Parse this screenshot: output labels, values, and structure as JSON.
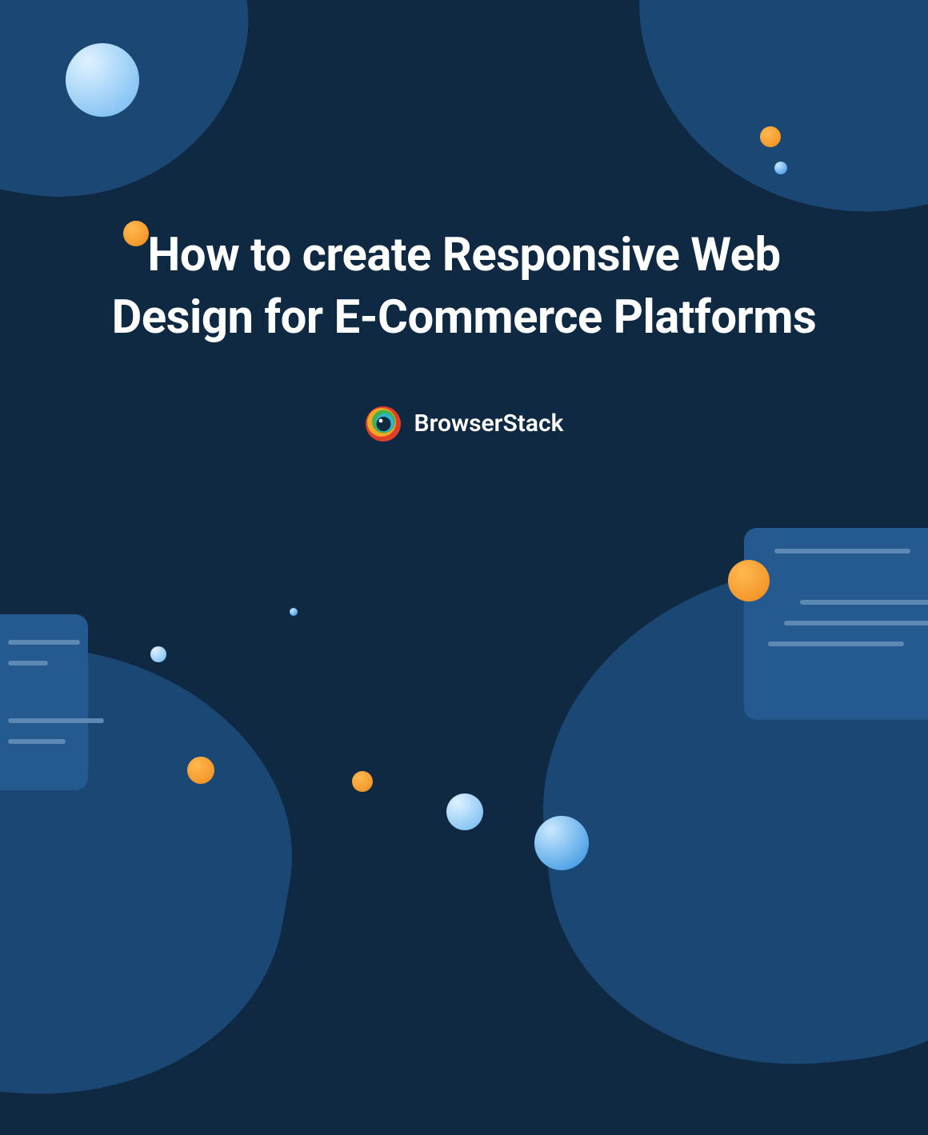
{
  "title": "How to create Responsive Web Design for E-Commerce Platforms",
  "brand": {
    "name": "BrowserStack"
  },
  "colors": {
    "bg_dark": "#0f2942",
    "blob": "#1b4775",
    "panel": "#245a8f",
    "orange": "#f08a1d",
    "light": "#ffffff"
  }
}
